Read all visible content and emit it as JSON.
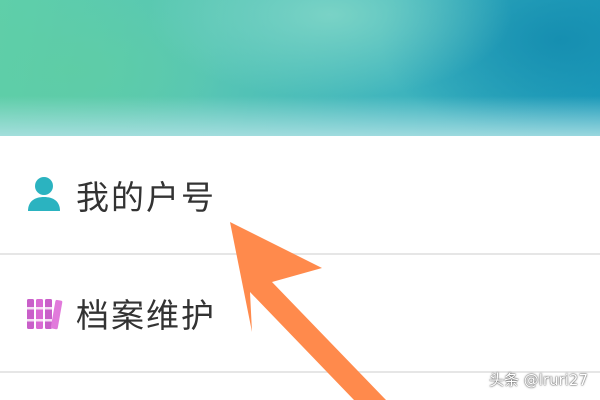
{
  "menu": {
    "items": [
      {
        "label": "我的户号",
        "icon": "person-icon",
        "icon_color": "#2bb3c0"
      },
      {
        "label": "档案维护",
        "icon": "archive-icon",
        "icon_color": "#c95fc9"
      }
    ]
  },
  "annotation": {
    "arrow_color": "#ff8a4c",
    "points_to": "我的户号"
  },
  "watermark": {
    "text": "头条 @lruri27"
  },
  "colors": {
    "banner_start": "#5fcfa9",
    "banner_end": "#1e9fbe",
    "divider": "#e6e6e6",
    "text": "#333333"
  }
}
